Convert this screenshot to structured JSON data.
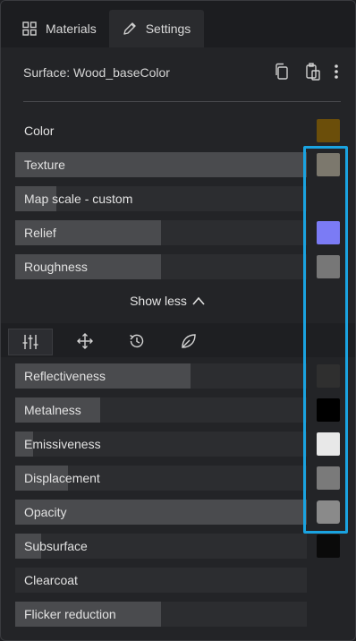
{
  "tabs": [
    {
      "label": "Materials",
      "icon": "grid-icon",
      "active": false
    },
    {
      "label": "Settings",
      "icon": "pencil-icon",
      "active": true
    }
  ],
  "surface": {
    "title": "Surface: Wood_baseColor",
    "actions": [
      "copy-icon",
      "paste-icon",
      "more-vertical-icon"
    ]
  },
  "color": {
    "label": "Color",
    "swatch": "#6b4e0a"
  },
  "properties_top": [
    {
      "label": "Texture",
      "value": 1.0
    },
    {
      "label": "Map scale - custom",
      "value": 0.14
    },
    {
      "label": "Relief",
      "value": 0.5
    },
    {
      "label": "Roughness",
      "value": 0.5
    }
  ],
  "show_less": {
    "label": "Show less",
    "icon": "chevron-up-icon"
  },
  "tools": [
    {
      "name": "sliders-icon",
      "active": true
    },
    {
      "name": "move-icon",
      "active": false
    },
    {
      "name": "history-icon",
      "active": false
    },
    {
      "name": "leaf-icon",
      "active": false
    }
  ],
  "properties_bottom": [
    {
      "label": "Reflectiveness",
      "value": 0.6
    },
    {
      "label": "Metalness",
      "value": 0.29
    },
    {
      "label": "Emissiveness",
      "value": 0.06
    },
    {
      "label": "Displacement",
      "value": 0.18
    },
    {
      "label": "Opacity",
      "value": 1.0
    },
    {
      "label": "Subsurface",
      "value": 0.09
    },
    {
      "label": "Clearcoat",
      "value": 0.0
    },
    {
      "label": "Flicker reduction",
      "value": 0.5
    }
  ],
  "swatch_colors": {
    "texture": "#7c786d",
    "relief": "#7b7bf5",
    "roughness": "#777777",
    "reflectiveness": "#2f2f2f",
    "metalness": "#000000",
    "emissiveness": "#e8e8e8",
    "displacement": "#7a7a7a",
    "opacity": "#8a8a8a",
    "subsurface": "#0a0a0a",
    "highlight": "#1aa3e0"
  }
}
